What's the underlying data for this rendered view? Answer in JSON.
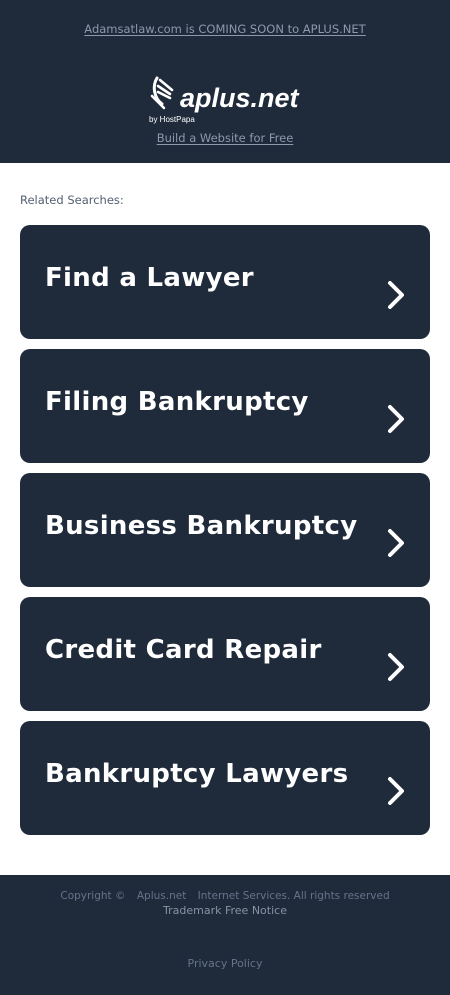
{
  "header": {
    "announcement": "Adamsatlaw.com is COMING SOON to APLUS.NET",
    "logo_wordmark": "aplus.net",
    "logo_byline": "by HostPapa",
    "build_link": "Build a Website for Free"
  },
  "related": {
    "label": "Related Searches:",
    "items": [
      {
        "label": "Find a Lawyer",
        "icon": "chevron-right-icon"
      },
      {
        "label": "Filing Bankruptcy",
        "icon": "chevron-right-icon"
      },
      {
        "label": "Business Bankruptcy",
        "icon": "chevron-right-icon"
      },
      {
        "label": "Credit Card Repair",
        "icon": "chevron-right-icon"
      },
      {
        "label": "Bankruptcy Lawyers",
        "icon": "chevron-right-icon"
      }
    ]
  },
  "footer": {
    "copyright": "Copyright ©",
    "site": "Aplus.net",
    "rights": "Internet Services. All rights reserved",
    "trademark": "Trademark Free Notice",
    "privacy": "Privacy Policy"
  },
  "colors": {
    "header_bg": "#1f2a3a",
    "card_bg": "#1f2a3a",
    "card_text": "#ffffff",
    "link_text": "#8d9aab",
    "page_bg": "#ffffff"
  }
}
